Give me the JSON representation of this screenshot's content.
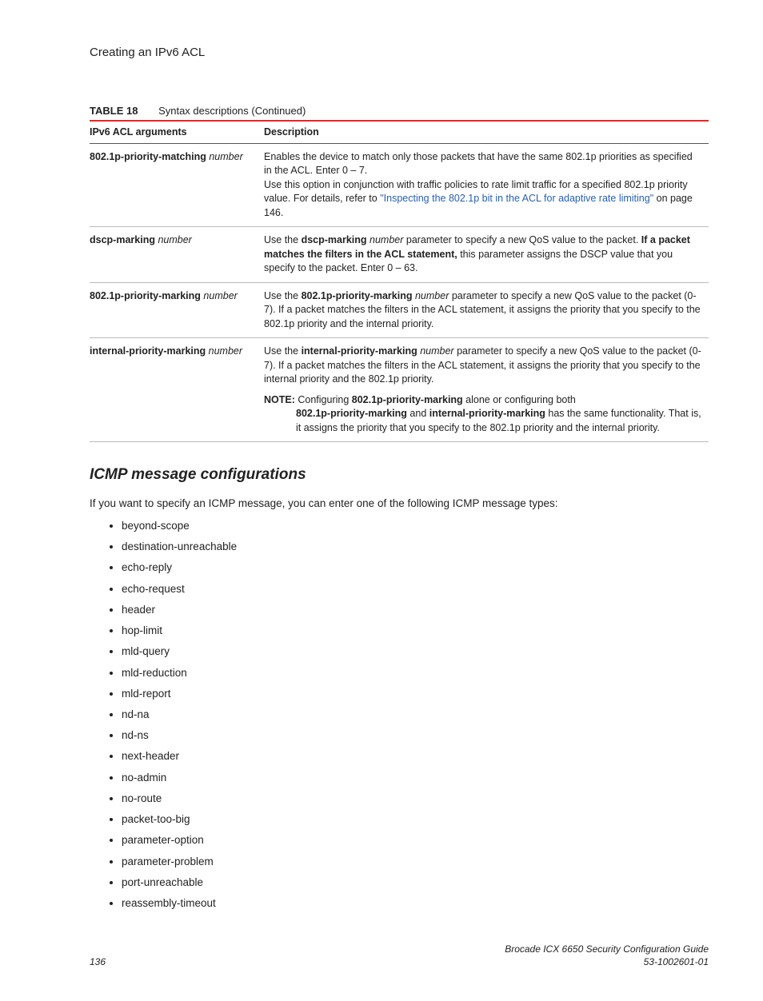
{
  "header": {
    "title": "Creating an IPv6 ACL"
  },
  "table": {
    "label": "TABLE 18",
    "caption": "Syntax descriptions (Continued)",
    "headers": {
      "col1": "IPv6 ACL arguments",
      "col2": "Description"
    },
    "rows": [
      {
        "arg_bold": "802.1p-priority-matching",
        "arg_ital": "number",
        "desc": {
          "p1": "Enables the device to match only those packets that have the same 802.1p priorities as specified in the ACL. Enter 0 – 7.",
          "p2_prefix": "Use this option in conjunction with traffic policies to rate limit traffic for a specified 802.1p priority value. For details, refer to ",
          "link": "\"Inspecting the 802.1p bit in the ACL for adaptive rate limiting\"",
          "p2_suffix": " on page 146."
        }
      },
      {
        "arg_bold": "dscp-marking",
        "arg_ital": "number",
        "desc": {
          "pre": "Use the ",
          "kw": "dscp-marking",
          "mid_i": " number",
          "mid": " parameter to specify a new QoS value to the packet. ",
          "bold2": "If a packet matches the filters in the ACL statement,",
          "post": " this parameter assigns the DSCP value that you specify to the packet. Enter 0 – 63."
        }
      },
      {
        "arg_bold": "802.1p-priority-marking",
        "arg_ital": "number",
        "desc": {
          "pre": "Use the ",
          "kw": "802.1p-priority-marking",
          "mid_i": " number",
          "post": " parameter to specify a new QoS value to the packet (0-7). If a packet matches the filters in the ACL statement, it assigns the priority that you specify to the 802.1p priority and the internal priority."
        }
      },
      {
        "arg_bold": "internal-priority-marking",
        "arg_ital": "number",
        "desc": {
          "pre": "Use the ",
          "kw": "internal-priority-marking",
          "mid_i": " number",
          "post": " parameter to specify a new QoS value to the packet (0-7). If a packet matches the filters in the ACL statement, it assigns the priority that you specify to the internal priority and the 802.1p priority.",
          "note_label": "NOTE:",
          "note_pre": "  Configuring ",
          "note_kw1": "802.1p-priority-marking",
          "note_mid1": " alone or configuring both ",
          "note_kw2": "802.1p-priority-marking",
          "note_mid2": " and ",
          "note_kw3": "internal-priority-marking",
          "note_post": " has the same functionality. That is, it assigns the priority that you specify to the 802.1p priority and the internal priority."
        }
      }
    ]
  },
  "section": {
    "heading": "ICMP message configurations",
    "intro": "If you want to specify an ICMP message, you can enter one of the following ICMP message types:",
    "items": [
      "beyond-scope",
      "destination-unreachable",
      "echo-reply",
      "echo-request",
      "header",
      "hop-limit",
      "mld-query",
      "mld-reduction",
      "mld-report",
      "nd-na",
      "nd-ns",
      "next-header",
      "no-admin",
      "no-route",
      "packet-too-big",
      "parameter-option",
      "parameter-problem",
      "port-unreachable",
      "reassembly-timeout"
    ]
  },
  "footer": {
    "page": "136",
    "doc_title": "Brocade ICX 6650 Security Configuration Guide",
    "doc_num": "53-1002601-01"
  }
}
